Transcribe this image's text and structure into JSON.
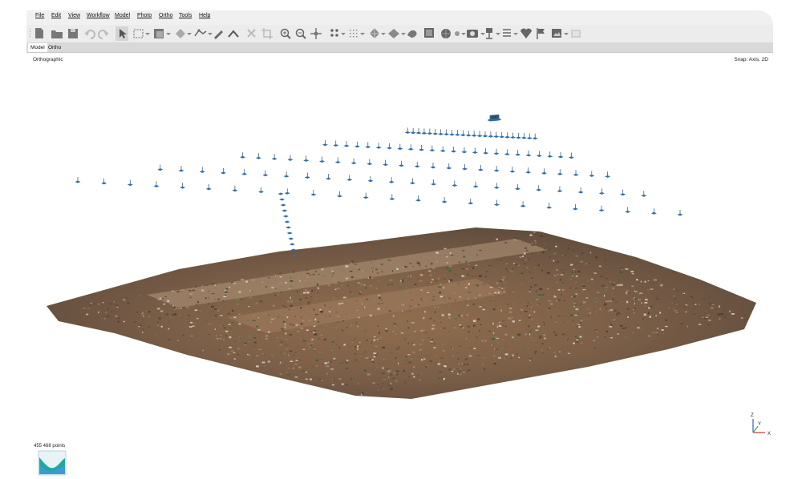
{
  "menu": {
    "items": [
      "File",
      "Edit",
      "View",
      "Workflow",
      "Model",
      "Photo",
      "Ortho",
      "Tools",
      "Help"
    ]
  },
  "toolbar": {
    "icons": [
      "new-icon",
      "open-icon",
      "save-icon",
      "undo-icon",
      "redo-icon",
      "navigation-icon",
      "rectangle-selection-icon",
      "resize-region-icon",
      "rotate-region-icon",
      "ruler-icon",
      "draw-polyline-icon",
      "shape-icon",
      "delete-icon",
      "crop-icon",
      "zoom-in-icon",
      "zoom-out-icon",
      "move-object-icon",
      "point-cloud-icon",
      "dense-cloud-icon",
      "mesh-icon",
      "tiled-model-icon",
      "dem-icon",
      "texture-icon",
      "orthomosaic-icon",
      "shaded-icon",
      "camera-icon",
      "show-cameras-icon",
      "list-icon",
      "markers-icon",
      "flag-icon",
      "image-icon",
      "screenshot-icon"
    ]
  },
  "tabs": [
    {
      "label": "Model",
      "active": true
    },
    {
      "label": "Ortho",
      "active": false
    }
  ],
  "viewport": {
    "projection": "Orthographic",
    "snap": "Snap: Axis, 2D",
    "points": "455 468 points",
    "axis_labels": {
      "z": "Z",
      "y": "Y",
      "x": "X"
    }
  },
  "colors": {
    "camera_blue": "#2f6fa6",
    "terrain_brown": "#8b6a4c",
    "vegetation_green": "#4e6b3c"
  }
}
